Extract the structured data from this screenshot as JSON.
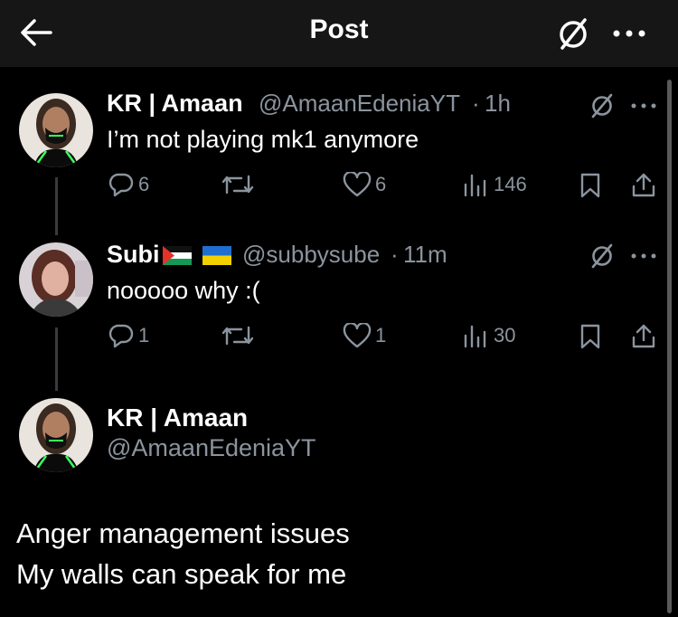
{
  "header": {
    "title": "Post"
  },
  "posts": [
    {
      "name": "KR | Amaan",
      "handle": "@AmaanEdeniaYT",
      "dot": "·",
      "time": "1h",
      "text": "I’m not playing mk1 anymore",
      "replies": "6",
      "likes": "6",
      "views": "146"
    },
    {
      "name": "Subi",
      "handle": "@subbysube",
      "dot": "·",
      "time": "11m",
      "text": "nooooo why :(",
      "replies": "1",
      "likes": "1",
      "views": "30"
    }
  ],
  "main_post": {
    "name": "KR | Amaan",
    "handle": "@AmaanEdeniaYT",
    "lines": [
      "Anger management issues",
      "My walls can speak for me"
    ]
  },
  "colors": {
    "background": "#000000",
    "topbar": "#161616",
    "muted": "#8b949e",
    "text": "#ffffff"
  }
}
